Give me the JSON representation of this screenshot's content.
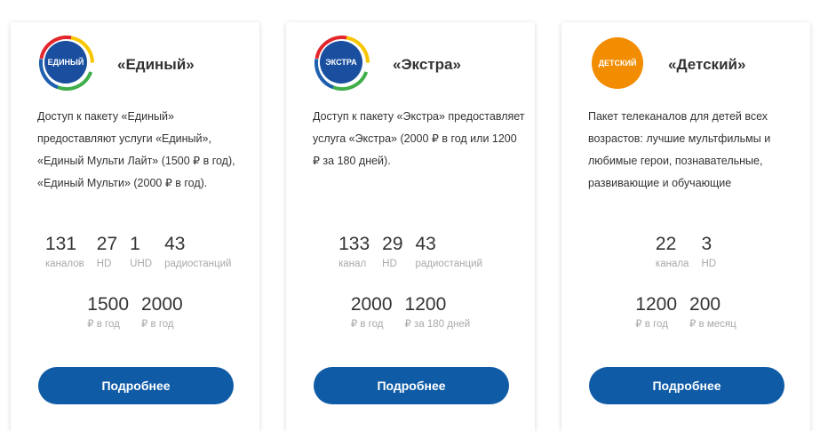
{
  "cards": [
    {
      "logo_text": "ЕДИНЫЙ",
      "title": "«Единый»",
      "description": "Доступ к пакету «Единый» предоставляют услуги «Единый», «Единый Мульти Лайт» (1500 ₽ в год), «Единый Мульти» (2000 ₽ в год).",
      "stats": [
        {
          "value": "131",
          "label": "каналов"
        },
        {
          "value": "27",
          "label": "HD"
        },
        {
          "value": "1",
          "label": "UHD"
        },
        {
          "value": "43",
          "label": "радиостанций"
        }
      ],
      "prices": [
        {
          "value": "1500",
          "label": "₽ в год"
        },
        {
          "value": "2000",
          "label": "₽ в год"
        }
      ],
      "button_label": "Подробнее"
    },
    {
      "logo_text": "ЭКСТРА",
      "title": "«Экстра»",
      "description": "Доступ к пакету «Экстра» предоставляет услуга «Экстра» (2000 ₽ в год или 1200 ₽ за 180 дней).",
      "stats": [
        {
          "value": "133",
          "label": "канал"
        },
        {
          "value": "29",
          "label": "HD"
        },
        {
          "value": "43",
          "label": "радиостанций"
        }
      ],
      "prices": [
        {
          "value": "2000",
          "label": "₽ в год"
        },
        {
          "value": "1200",
          "label": "₽ за 180 дней"
        }
      ],
      "button_label": "Подробнее"
    },
    {
      "logo_text": "ДЕТСКИЙ",
      "title": "«Детский»",
      "description": "Пакет телеканалов для детей всех возрастов: лучшие мультфильмы и любимые герои, познавательные, развивающие и обучающие",
      "stats": [
        {
          "value": "22",
          "label": "канала"
        },
        {
          "value": "3",
          "label": "HD"
        }
      ],
      "prices": [
        {
          "value": "1200",
          "label": "₽ в год"
        },
        {
          "value": "200",
          "label": "₽ в месяц"
        }
      ],
      "button_label": "Подробнее"
    }
  ],
  "colors": {
    "button": "#0f5ba6",
    "logo_blue": "#1a4fa0",
    "logo_orange": "#f28c00",
    "ring_red": "#e3262b",
    "ring_green": "#3fae49",
    "ring_yellow": "#f7c600",
    "ring_blue": "#1e5fb0"
  }
}
